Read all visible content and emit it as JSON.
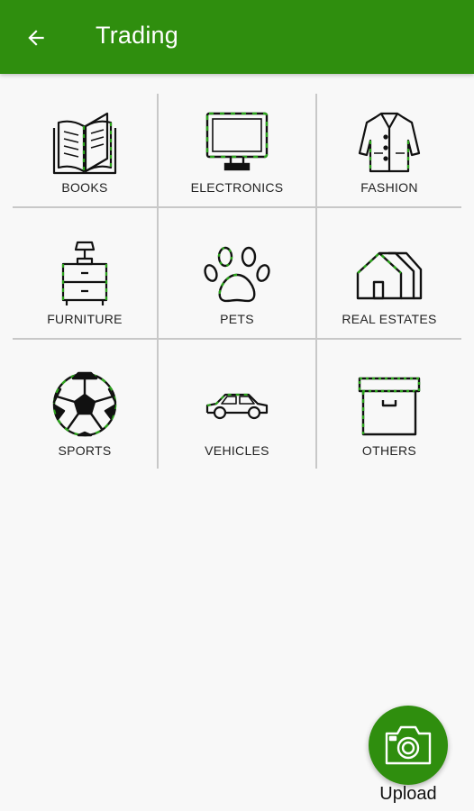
{
  "appbar": {
    "title": "Trading",
    "back_icon": "arrow-left-icon"
  },
  "categories": [
    {
      "label": "BOOKS",
      "icon": "book-icon"
    },
    {
      "label": "ELECTRONICS",
      "icon": "monitor-icon"
    },
    {
      "label": "FASHION",
      "icon": "coat-icon"
    },
    {
      "label": "FURNITURE",
      "icon": "nightstand-lamp-icon"
    },
    {
      "label": "PETS",
      "icon": "paw-icon"
    },
    {
      "label": "REAL ESTATES",
      "icon": "houses-icon"
    },
    {
      "label": "SPORTS",
      "icon": "soccer-ball-icon"
    },
    {
      "label": "VEHICLES",
      "icon": "car-icon"
    },
    {
      "label": "OTHERS",
      "icon": "box-icon"
    }
  ],
  "fab": {
    "label": "Upload",
    "icon": "camera-icon"
  },
  "colors": {
    "primary": "#2f8e0e",
    "icon_stroke": "#111111",
    "icon_accent": "#2aa31a",
    "divider": "#c8c8c8"
  }
}
